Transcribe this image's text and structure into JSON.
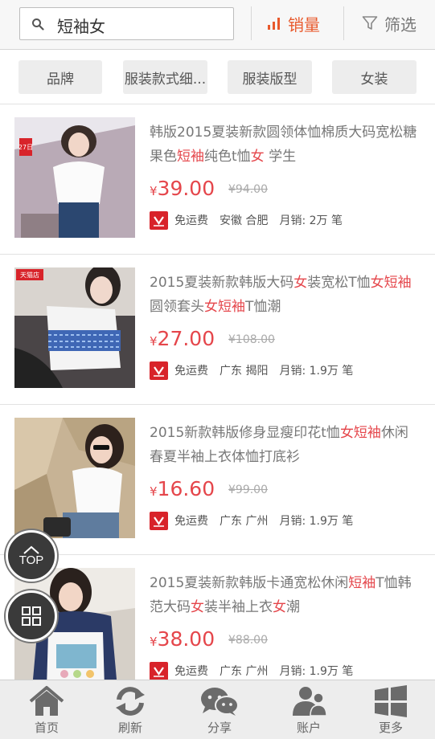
{
  "search": {
    "query": "短袖女"
  },
  "sort": {
    "sales_label": "销量",
    "filter_label": "筛选",
    "accent": "#e8592c"
  },
  "chips": [
    "品牌",
    "服装款式细...",
    "服装版型",
    "女装"
  ],
  "products": [
    {
      "title_parts": [
        [
          "韩版2015夏装新款圆领体恤棉质大码宽松糖果色",
          false
        ],
        [
          "短袖",
          true
        ],
        [
          "纯色t恤",
          false
        ],
        [
          "女",
          true
        ],
        [
          " 学生",
          false
        ]
      ],
      "currency": "¥",
      "price": "39.00",
      "old_price": "¥94.00",
      "shipping": "免运费",
      "location": "安徽 合肥",
      "sales": "月销: 2万 笔",
      "badge": "27日"
    },
    {
      "title_parts": [
        [
          "2015夏装新款韩版大码",
          false
        ],
        [
          "女",
          true
        ],
        [
          "装宽松T恤",
          false
        ],
        [
          "女短袖",
          true
        ],
        [
          "圆领套头",
          false
        ],
        [
          "女短袖",
          true
        ],
        [
          "T恤潮",
          false
        ]
      ],
      "currency": "¥",
      "price": "27.00",
      "old_price": "¥108.00",
      "shipping": "免运费",
      "location": "广东 揭阳",
      "sales": "月销: 1.9万 笔",
      "badge": "天猫店"
    },
    {
      "title_parts": [
        [
          "2015新款韩版修身显瘦印花t恤",
          false
        ],
        [
          "女短袖",
          true
        ],
        [
          "休闲春夏半袖上衣体恤打底衫",
          false
        ]
      ],
      "currency": "¥",
      "price": "16.60",
      "old_price": "¥99.00",
      "shipping": "免运费",
      "location": "广东 广州",
      "sales": "月销: 1.9万 笔",
      "badge": ""
    },
    {
      "title_parts": [
        [
          "2015夏装新款韩版卡通宽松休闲",
          false
        ],
        [
          "短袖",
          true
        ],
        [
          "T恤韩范大码",
          false
        ],
        [
          "女",
          true
        ],
        [
          "装半袖上衣",
          false
        ],
        [
          "女",
          true
        ],
        [
          "潮",
          false
        ]
      ],
      "currency": "¥",
      "price": "38.00",
      "old_price": "¥88.00",
      "shipping": "免运费",
      "location": "广东 广州",
      "sales": "月销: 1.9万 笔",
      "badge": ""
    }
  ],
  "float": {
    "top_label": "TOP"
  },
  "nav": [
    "首页",
    "刷新",
    "分享",
    "账户",
    "更多"
  ],
  "colors": {
    "price_red": "#e5464b",
    "mark_red": "#d8232a"
  }
}
